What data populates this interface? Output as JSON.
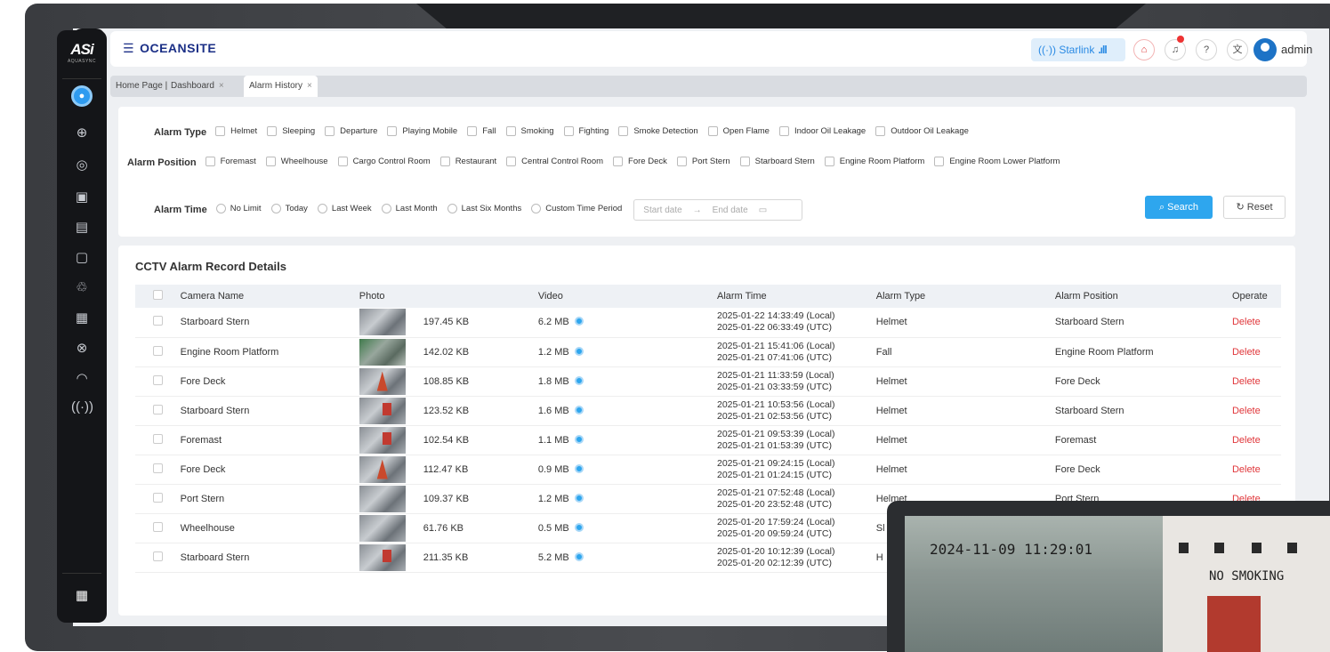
{
  "logo": {
    "main": "ASi",
    "sub": "AQUASYNC"
  },
  "header": {
    "brand": "OCEANSITE",
    "starlink_label": "Starlink",
    "user": "admin"
  },
  "tabs": [
    {
      "label": "Home Page"
    },
    {
      "label": "Dashboard"
    },
    {
      "label": "Alarm History"
    }
  ],
  "filters": {
    "alarm_type_label": "Alarm Type",
    "alarm_types": [
      "Helmet",
      "Sleeping",
      "Departure",
      "Playing Mobile",
      "Fall",
      "Smoking",
      "Fighting",
      "Smoke Detection",
      "Open Flame",
      "Indoor Oil Leakage",
      "Outdoor Oil Leakage"
    ],
    "alarm_position_label": "Alarm Position",
    "alarm_positions": [
      "Foremast",
      "Wheelhouse",
      "Cargo Control Room",
      "Restaurant",
      "Central Control Room",
      "Fore Deck",
      "Port Stern",
      "Starboard Stern",
      "Engine Room Platform",
      "Engine Room Lower Platform"
    ],
    "alarm_time_label": "Alarm Time",
    "alarm_times": [
      "No Limit",
      "Today",
      "Last Week",
      "Last Month",
      "Last Six Months",
      "Custom Time Period"
    ],
    "start_placeholder": "Start date",
    "end_placeholder": "End date",
    "search_label": "Search",
    "reset_label": "Reset"
  },
  "records": {
    "title": "CCTV Alarm Record Details",
    "columns": [
      "Camera Name",
      "Photo",
      "Video",
      "Alarm Time",
      "Alarm Type",
      "Alarm Position",
      "Operate"
    ],
    "rows": [
      {
        "camera": "Starboard Stern",
        "photo_size": "197.45 KB",
        "video": "6.2 MB",
        "local": "2025-01-22 14:33:49  (Local)",
        "utc": "2025-01-22 06:33:49  (UTC)",
        "type": "Helmet",
        "position": "Starboard Stern",
        "op": "Delete"
      },
      {
        "camera": "Engine Room Platform",
        "photo_size": "142.02 KB",
        "video": "1.2 MB",
        "local": "2025-01-21 15:41:06  (Local)",
        "utc": "2025-01-21 07:41:06  (UTC)",
        "type": "Fall",
        "position": "Engine Room Platform",
        "op": "Delete"
      },
      {
        "camera": "Fore Deck",
        "photo_size": "108.85 KB",
        "video": "1.8 MB",
        "local": "2025-01-21 11:33:59  (Local)",
        "utc": "2025-01-21 03:33:59  (UTC)",
        "type": "Helmet",
        "position": "Fore Deck",
        "op": "Delete"
      },
      {
        "camera": "Starboard Stern",
        "photo_size": "123.52 KB",
        "video": "1.6 MB",
        "local": "2025-01-21 10:53:56  (Local)",
        "utc": "2025-01-21 02:53:56  (UTC)",
        "type": "Helmet",
        "position": "Starboard Stern",
        "op": "Delete"
      },
      {
        "camera": "Foremast",
        "photo_size": "102.54 KB",
        "video": "1.1 MB",
        "local": "2025-01-21 09:53:39  (Local)",
        "utc": "2025-01-21 01:53:39  (UTC)",
        "type": "Helmet",
        "position": "Foremast",
        "op": "Delete"
      },
      {
        "camera": "Fore Deck",
        "photo_size": "112.47 KB",
        "video": "0.9 MB",
        "local": "2025-01-21 09:24:15  (Local)",
        "utc": "2025-01-21 01:24:15  (UTC)",
        "type": "Helmet",
        "position": "Fore Deck",
        "op": "Delete"
      },
      {
        "camera": "Port Stern",
        "photo_size": "109.37 KB",
        "video": "1.2 MB",
        "local": "2025-01-21 07:52:48  (Local)",
        "utc": "2025-01-20 23:52:48  (UTC)",
        "type": "Helmet",
        "position": "Port Stern",
        "op": "Delete"
      },
      {
        "camera": "Wheelhouse",
        "photo_size": "61.76 KB",
        "video": "0.5 MB",
        "local": "2025-01-20 17:59:24  (Local)",
        "utc": "2025-01-20 09:59:24  (UTC)",
        "type": "Sl",
        "position": "",
        "op": ""
      },
      {
        "camera": "Starboard Stern",
        "photo_size": "211.35 KB",
        "video": "5.2 MB",
        "local": "2025-01-20 10:12:39  (Local)",
        "utc": "2025-01-20 02:12:39  (UTC)",
        "type": "H",
        "position": "",
        "op": ""
      }
    ]
  },
  "cctv": {
    "timestamp": "2024-11-09 11:29:01",
    "sign": "NO SMOKING"
  },
  "colors": {
    "accent": "#2ea6ee",
    "brand": "#1b2f86",
    "danger": "#e0363a",
    "sidebar": "#141518"
  }
}
